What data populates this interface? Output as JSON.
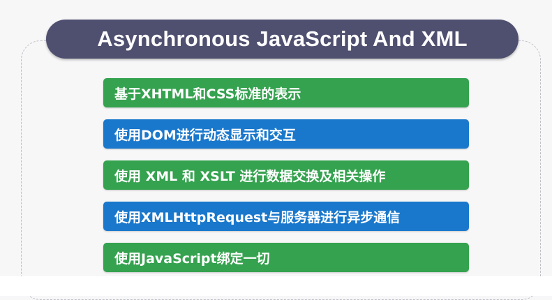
{
  "title": "Asynchronous JavaScript And XML",
  "colors": {
    "title_bg": "#4f4f70",
    "green": "#35a24f",
    "blue": "#1a78cc"
  },
  "items": [
    {
      "label": "基于XHTML和CSS标准的表示",
      "color": "green"
    },
    {
      "label": "使用DOM进行动态显示和交互",
      "color": "blue"
    },
    {
      "label": "使用 XML 和 XSLT 进行数据交换及相关操作",
      "color": "green"
    },
    {
      "label": "使用XMLHttpRequest与服务器进行异步通信",
      "color": "blue"
    },
    {
      "label": "使用JavaScript绑定一切",
      "color": "green"
    }
  ]
}
